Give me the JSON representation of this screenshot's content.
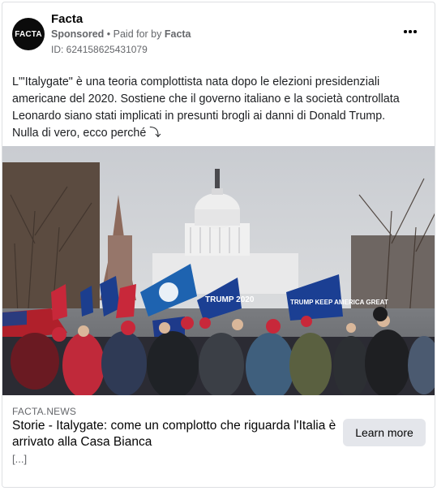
{
  "ad": {
    "page_name": "Facta",
    "avatar_text": "FACTA",
    "sponsored": "Sponsored",
    "separator": " • ",
    "paid_for_prefix": "Paid for by ",
    "paid_for_name": "Facta",
    "ad_id": "ID: 624158625431079",
    "more_icon": "more-horizontal-icon"
  },
  "body": {
    "paragraph": "L\"'Italygate\" è una teoria complottista nata dopo le elezioni presidenziali americane del 2020. Sostiene che il governo italiano e la società controllata Leonardo siano stati implicati in presunti brogli ai danni di Donald Trump.",
    "line2": "Nulla di vero, ecco perché ⤵"
  },
  "image": {
    "flag_texts": [
      "TRUMP 2020",
      "TRUMP KEEP AMERICA GREAT"
    ]
  },
  "link": {
    "domain": "FACTA.NEWS",
    "headline": "Storie - Italygate: come un complotto che riguarda l'Italia è arrivato alla Casa Bianca",
    "description": "[...]",
    "cta_label": "Learn more"
  },
  "colors": {
    "secondary_text": "#65676b",
    "button_bg": "#e4e6eb"
  }
}
